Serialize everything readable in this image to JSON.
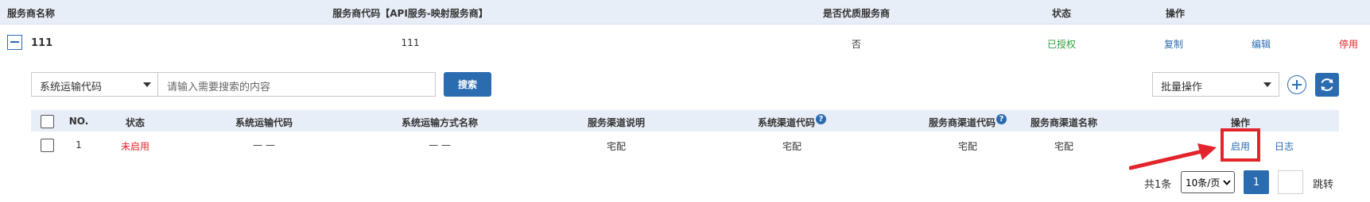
{
  "outer_table": {
    "headers": {
      "name": "服务商名称",
      "code": "服务商代码【API服务-映射服务商】",
      "quality": "是否优质服务商",
      "status": "状态",
      "actions": "操作"
    },
    "row": {
      "name": "111",
      "code": "111",
      "quality": "否",
      "status": "已授权",
      "copy": "复制",
      "edit": "编辑",
      "disable": "停用"
    }
  },
  "search": {
    "field_select": "系统运输代码",
    "placeholder": "请输入需要搜索的内容",
    "button": "搜索"
  },
  "bulk": {
    "select": "批量操作"
  },
  "inner_table": {
    "headers": {
      "no": "NO.",
      "status": "状态",
      "sys_code": "系统运输代码",
      "sys_name": "系统运输方式名称",
      "channel_desc": "服务渠道说明",
      "sys_channel_code": "系统渠道代码",
      "prov_channel_code": "服务商渠道代码",
      "prov_channel_name": "服务商渠道名称",
      "actions": "操作"
    },
    "rows": [
      {
        "no": "1",
        "status": "未启用",
        "sys_code": "— —",
        "sys_name": "— —",
        "channel_desc": "宅配",
        "sys_channel_code": "宅配",
        "prov_channel_code": "宅配",
        "prov_channel_name": "宅配",
        "enable": "启用",
        "log": "日志"
      }
    ]
  },
  "pagination": {
    "total": "共1条",
    "page_size": "10条/页",
    "current": "1",
    "jump": "跳转"
  },
  "colors": {
    "accent": "#2b6cb0",
    "success": "#2e9e3e",
    "danger": "#e3242b",
    "header_bg": "#e8eef7"
  }
}
